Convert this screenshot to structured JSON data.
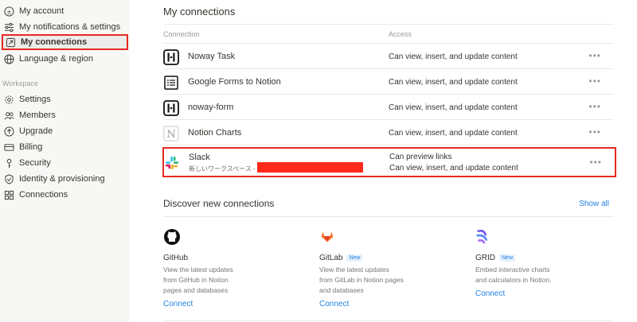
{
  "sidebar": {
    "items": [
      {
        "label": "My account",
        "icon": "account-icon"
      },
      {
        "label": "My notifications & settings",
        "icon": "sliders-icon"
      },
      {
        "label": "My connections",
        "icon": "connections-arrow-icon",
        "active": true
      },
      {
        "label": "Language & region",
        "icon": "globe-icon"
      }
    ],
    "section_label": "Workspace",
    "workspace_items": [
      {
        "label": "Settings",
        "icon": "gear-icon"
      },
      {
        "label": "Members",
        "icon": "members-icon"
      },
      {
        "label": "Upgrade",
        "icon": "upgrade-icon"
      },
      {
        "label": "Billing",
        "icon": "billing-icon"
      },
      {
        "label": "Security",
        "icon": "key-icon"
      },
      {
        "label": "Identity & provisioning",
        "icon": "shield-icon"
      },
      {
        "label": "Connections",
        "icon": "grid-icon"
      }
    ]
  },
  "main": {
    "title": "My connections",
    "columns": {
      "connection": "Connection",
      "access": "Access"
    },
    "connections": [
      {
        "name": "Noway Task",
        "access": "Can view, insert, and update content",
        "icon": "noway-logo-icon"
      },
      {
        "name": "Google Forms to Notion",
        "access": "Can view, insert, and update content",
        "icon": "list-logo-icon"
      },
      {
        "name": "noway-form",
        "access": "Can view, insert, and update content",
        "icon": "noway-logo-icon"
      },
      {
        "name": "Notion Charts",
        "access": "Can view, insert, and update content",
        "icon": "notion-n-logo-icon"
      }
    ],
    "slack": {
      "name": "Slack",
      "workspace": "新しいワークスペース -",
      "access_1": "Can preview links",
      "access_2": "Can view, insert, and update content",
      "icon": "slack-logo-icon"
    },
    "more_label": "•••",
    "discover": {
      "title": "Discover new connections",
      "show_all": "Show all",
      "cards": [
        {
          "name": "GitHub",
          "badge": "",
          "desc_lines": [
            "View the latest updates",
            "from GitHub in Notion",
            "pages and databases"
          ],
          "connect": "Connect",
          "icon": "github-logo-icon"
        },
        {
          "name": "GitLab",
          "badge": "New",
          "desc_lines": [
            "View the latest updates",
            "from GitLab in Notion pages",
            "and databases"
          ],
          "connect": "Connect",
          "icon": "gitlab-logo-icon"
        },
        {
          "name": "GRID",
          "badge": "New",
          "desc_lines": [
            "Embed interactive charts",
            "and calculators in Notion."
          ],
          "connect": "Connect",
          "icon": "grid-app-logo-icon"
        }
      ]
    }
  },
  "colors": {
    "accent": "#2383e2",
    "highlight": "#e62a20",
    "sidebar_bg": "#f7f7f5"
  }
}
